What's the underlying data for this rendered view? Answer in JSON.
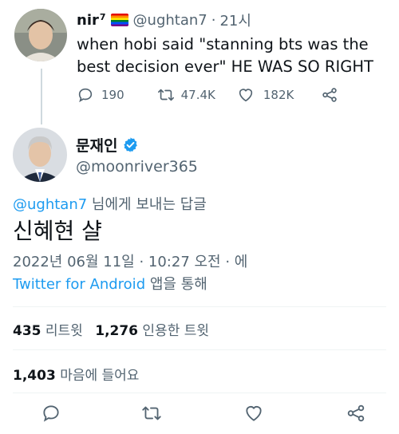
{
  "parent_tweet": {
    "display_name": "nir",
    "name_superscript": "7",
    "handle": "@ughtan7",
    "separator": "·",
    "time": "21시",
    "text": "when hobi said \"stanning bts was the best decision ever\" HE WAS SO RIGHT",
    "replies": "190",
    "retweets": "47.4K",
    "likes": "182K"
  },
  "main_tweet": {
    "display_name": "문재인",
    "handle": "@moonriver365",
    "reply_to_handle": "@ughtan7",
    "reply_to_suffix": " 님에게 보내는 답글",
    "text": "신혜현 샬",
    "timestamp": "2022년 06월 11일 · 10:27 오전 · 에",
    "source": "Twitter for Android",
    "source_suffix": " 앱을 통해",
    "retweet_count": "435",
    "retweet_label": "리트윗",
    "quote_count": "1,276",
    "quote_label": "인용한 트윗",
    "like_count": "1,403",
    "like_label": "마음에 들어요"
  },
  "colors": {
    "link": "#1d9bf0",
    "secondary_text": "#536471",
    "verified": "#1d9bf0",
    "divider": "#eff3f4"
  },
  "icons": [
    "reply-icon",
    "retweet-icon",
    "like-icon",
    "share-icon",
    "verified-badge-icon",
    "pride-flag-icon"
  ]
}
